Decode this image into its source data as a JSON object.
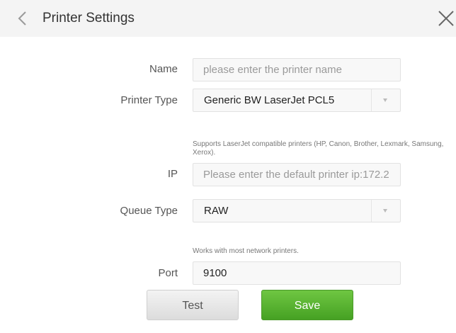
{
  "header": {
    "title": "Printer Settings",
    "back_icon": "chevron-left-icon",
    "close_icon": "close-icon"
  },
  "form": {
    "name": {
      "label": "Name",
      "value": "",
      "placeholder": "please enter the printer name"
    },
    "printer_type": {
      "label": "Printer Type",
      "value": "Generic BW LaserJet PCL5",
      "hint": "Supports LaserJet compatible printers (HP, Canon, Brother, Lexmark, Samsung, Xerox)."
    },
    "ip": {
      "label": "IP",
      "value": "",
      "placeholder": "Please enter the default printer ip:172.2..."
    },
    "queue_type": {
      "label": "Queue Type",
      "value": "RAW",
      "hint": "Works with most network printers."
    },
    "port": {
      "label": "Port",
      "value": "9100"
    }
  },
  "actions": {
    "test_label": "Test",
    "save_label": "Save"
  },
  "colors": {
    "save_button": "#5bb531",
    "header_bg": "#f4f4f4"
  }
}
